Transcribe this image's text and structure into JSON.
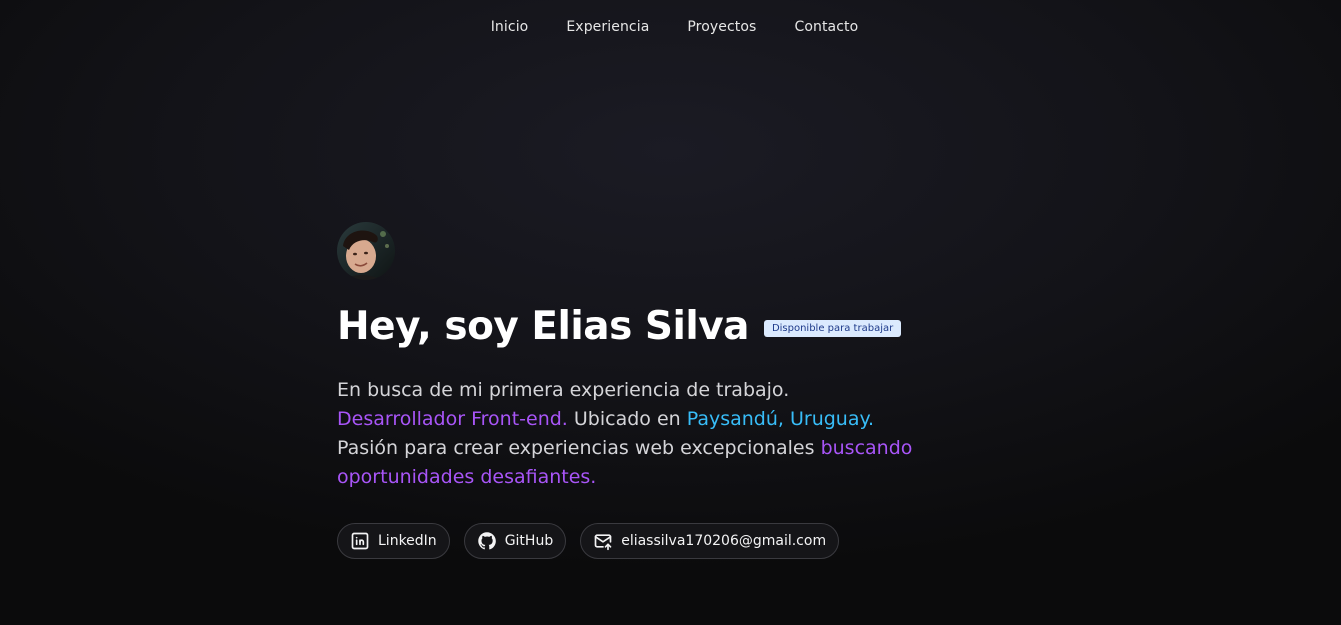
{
  "nav": {
    "items": [
      {
        "label": "Inicio"
      },
      {
        "label": "Experiencia"
      },
      {
        "label": "Proyectos"
      },
      {
        "label": "Contacto"
      }
    ]
  },
  "hero": {
    "title": "Hey, soy Elias Silva",
    "badge": "Disponible para trabajar",
    "bio": {
      "line1": "En busca de mi primera experiencia de trabajo.",
      "role": "Desarrollador Front-end.",
      "location_prefix": " Ubicado en ",
      "location": "Paysandú, Uruguay.",
      "passion": "Pasión para crear experiencias web excepcionales ",
      "goal": "buscando oportunidades desafiantes."
    }
  },
  "links": {
    "linkedin": {
      "label": "LinkedIn",
      "icon": "linkedin-icon"
    },
    "github": {
      "label": "GitHub",
      "icon": "github-icon"
    },
    "email": {
      "label": "eliassilva170206@gmail.com",
      "icon": "mail-icon"
    }
  },
  "colors": {
    "accent_purple": "#a855f7",
    "accent_cyan": "#38bdf8",
    "badge_bg": "#dbeafe",
    "badge_text": "#1e3a8a"
  }
}
